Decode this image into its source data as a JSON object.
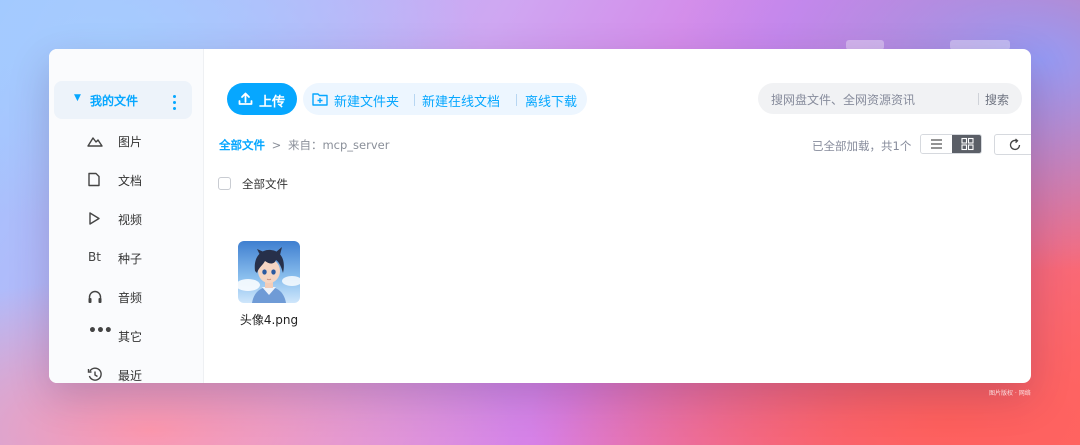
{
  "sidebar": {
    "header": {
      "label": "我的文件",
      "caret_icon": "caret-down-icon",
      "more_icon": "more-vertical-icon"
    },
    "items": [
      {
        "label": "图片",
        "icon": "image-icon"
      },
      {
        "label": "文档",
        "icon": "document-icon"
      },
      {
        "label": "视频",
        "icon": "play-icon"
      },
      {
        "label": "种子",
        "icon": "bt-icon",
        "icon_text": "Bt"
      },
      {
        "label": "音频",
        "icon": "headphones-icon"
      },
      {
        "label": "其它",
        "icon": "more-horizontal-icon",
        "icon_text": "•••"
      },
      {
        "label": "最近",
        "icon": "history-icon"
      }
    ]
  },
  "toolbar": {
    "upload_label": "上传",
    "new_folder_label": "新建文件夹",
    "new_doc_label": "新建在线文档",
    "offline_download_label": "离线下载"
  },
  "search": {
    "placeholder": "搜网盘文件、全网资源资讯",
    "button_label": "搜索"
  },
  "breadcrumb": {
    "root": "全部文件",
    "separator": ">",
    "source": "来自：mcp_server"
  },
  "status": {
    "loaded_text": "已全部加载，共1个"
  },
  "list": {
    "select_all_label": "全部文件"
  },
  "files": [
    {
      "name": "头像4.png",
      "type": "image"
    }
  ],
  "watermark": "图片版权 · 网络",
  "colors": {
    "accent": "#06a7ff",
    "accent_light": "#edf6ff",
    "sidebar_active": "#edf3fa"
  }
}
